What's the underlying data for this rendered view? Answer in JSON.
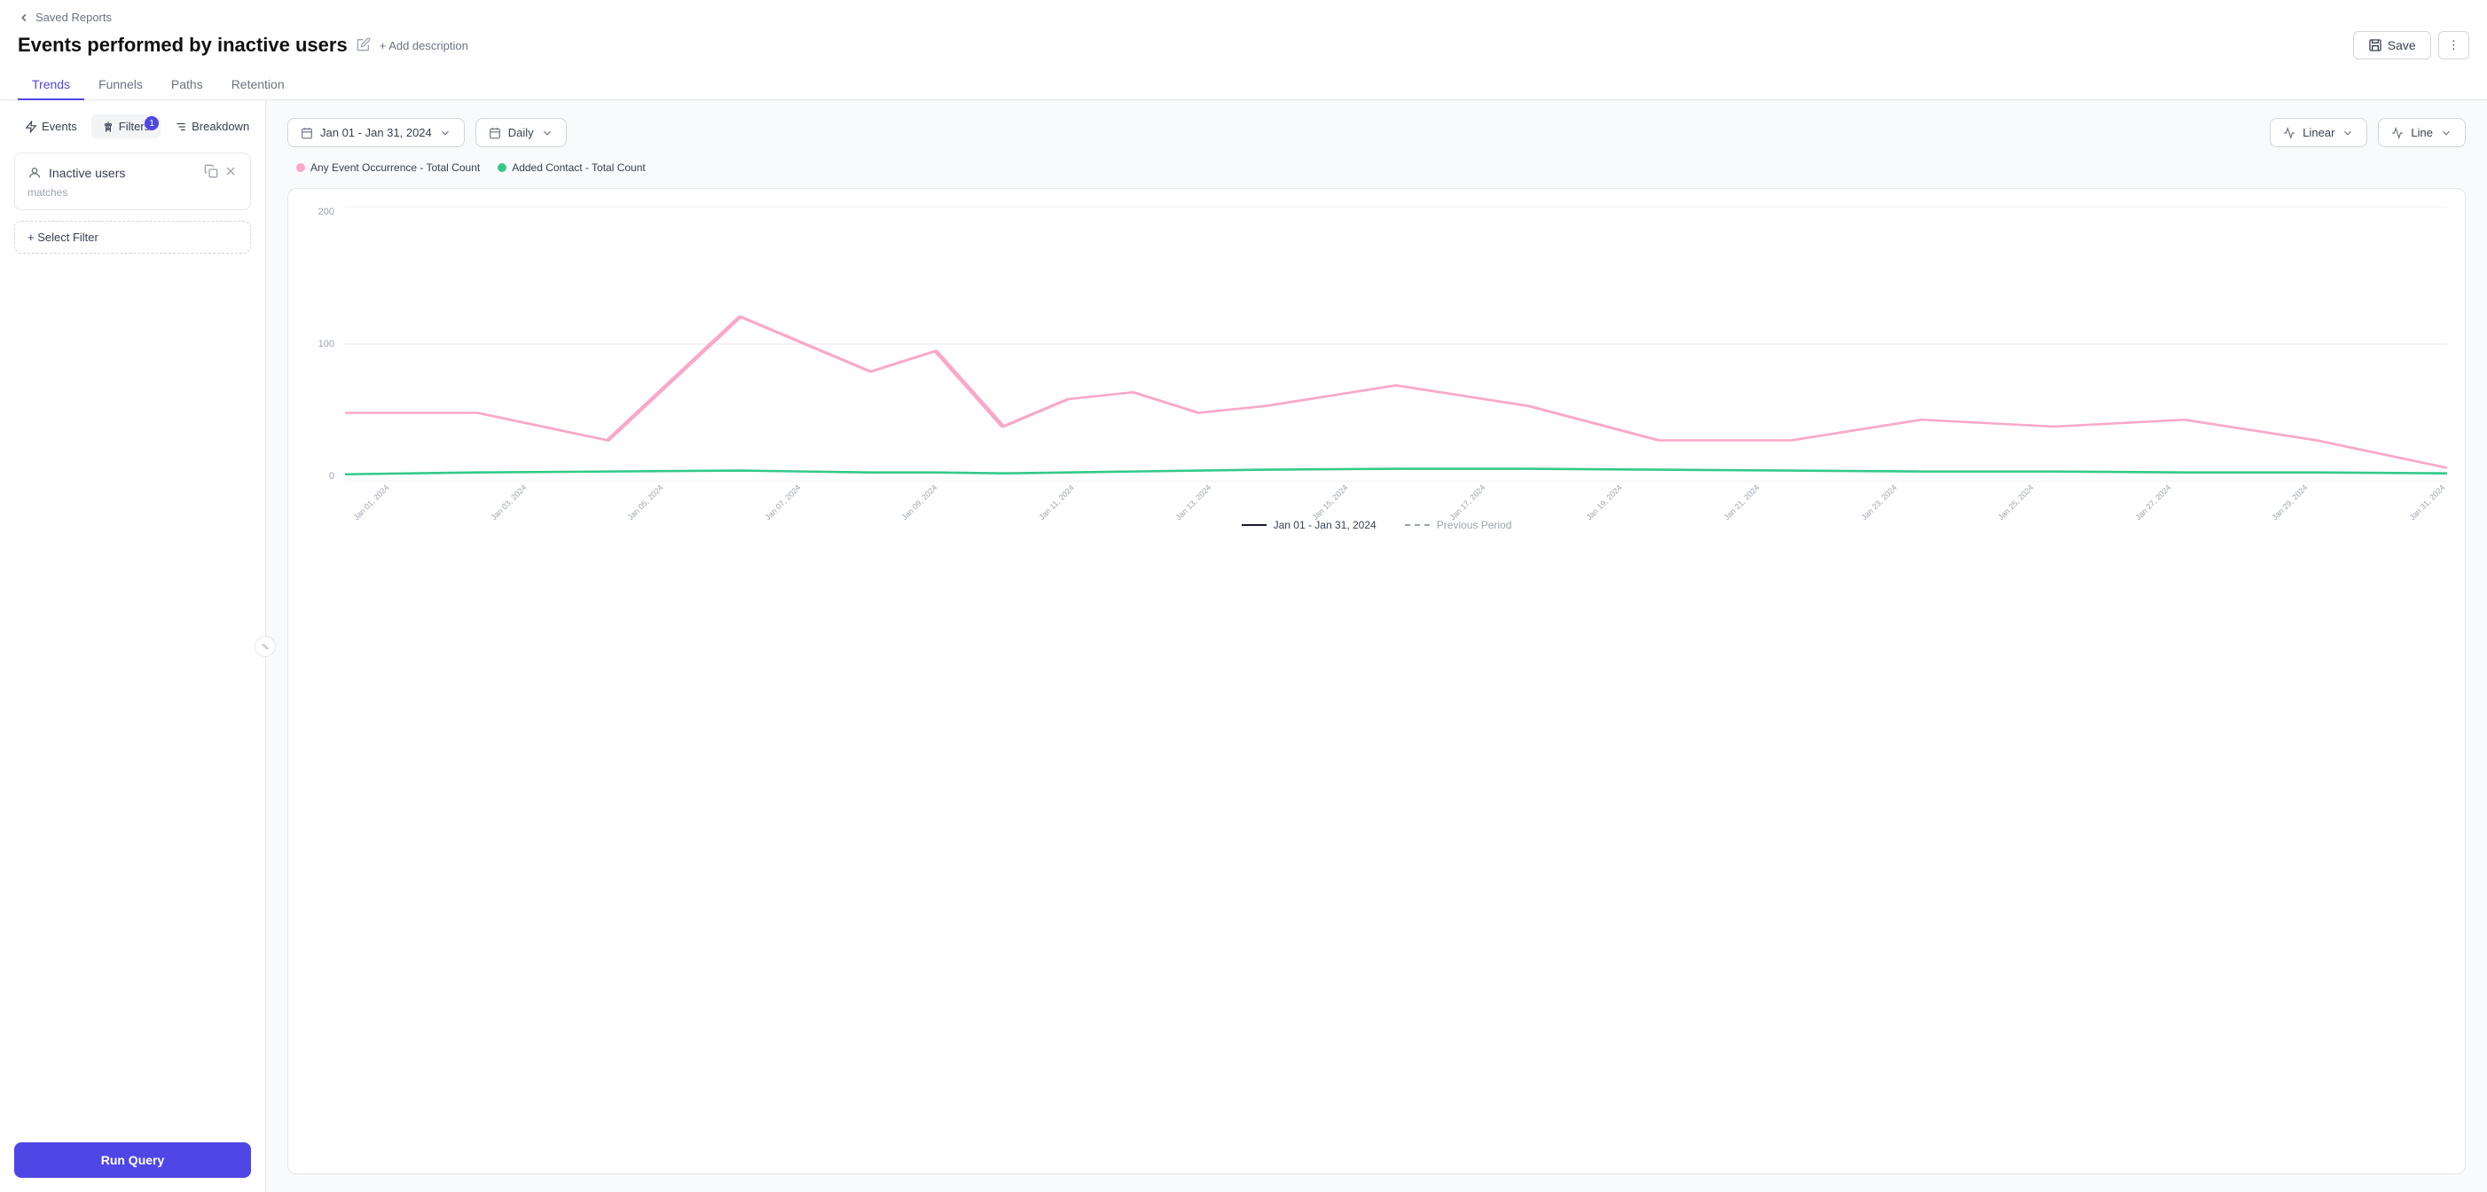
{
  "breadcrumb": {
    "label": "Saved Reports"
  },
  "header": {
    "title": "Events performed by inactive users",
    "add_description": "+ Add description",
    "save_label": "Save",
    "more_label": "⋮"
  },
  "tabs": [
    {
      "label": "Trends",
      "active": true
    },
    {
      "label": "Funnels",
      "active": false
    },
    {
      "label": "Paths",
      "active": false
    },
    {
      "label": "Retention",
      "active": false
    }
  ],
  "panel": {
    "events_label": "Events",
    "filters_label": "Filters",
    "breakdown_label": "Breakdown",
    "filters_badge": "1",
    "filter_card": {
      "title": "Inactive users",
      "matches": "matches"
    },
    "select_filter_label": "+ Select Filter",
    "run_query_label": "Run Query"
  },
  "chart": {
    "date_range": "Jan 01 - Jan 31, 2024",
    "interval": "Daily",
    "scale": "Linear",
    "chart_type": "Line",
    "legend": [
      {
        "label": "Any Event Occurrence - Total Count",
        "color": "#f9a8c9"
      },
      {
        "label": "Added Contact - Total Count",
        "color": "#34c98a"
      }
    ],
    "y_axis": [
      "200",
      "100",
      "0"
    ],
    "x_labels": [
      "Jan 01, 2024",
      "Jan 03, 2024",
      "Jan 05, 2024",
      "Jan 07, 2024",
      "Jan 09, 2024",
      "Jan 11, 2024",
      "Jan 13, 2024",
      "Jan 15, 2024",
      "Jan 17, 2024",
      "Jan 19, 2024",
      "Jan 21, 2024",
      "Jan 23, 2024",
      "Jan 25, 2024",
      "Jan 27, 2024",
      "Jan 29, 2024",
      "Jan 31, 2024"
    ],
    "bottom_legend": {
      "current": "Jan 01 - Jan 31, 2024",
      "previous": "Previous Period"
    }
  }
}
